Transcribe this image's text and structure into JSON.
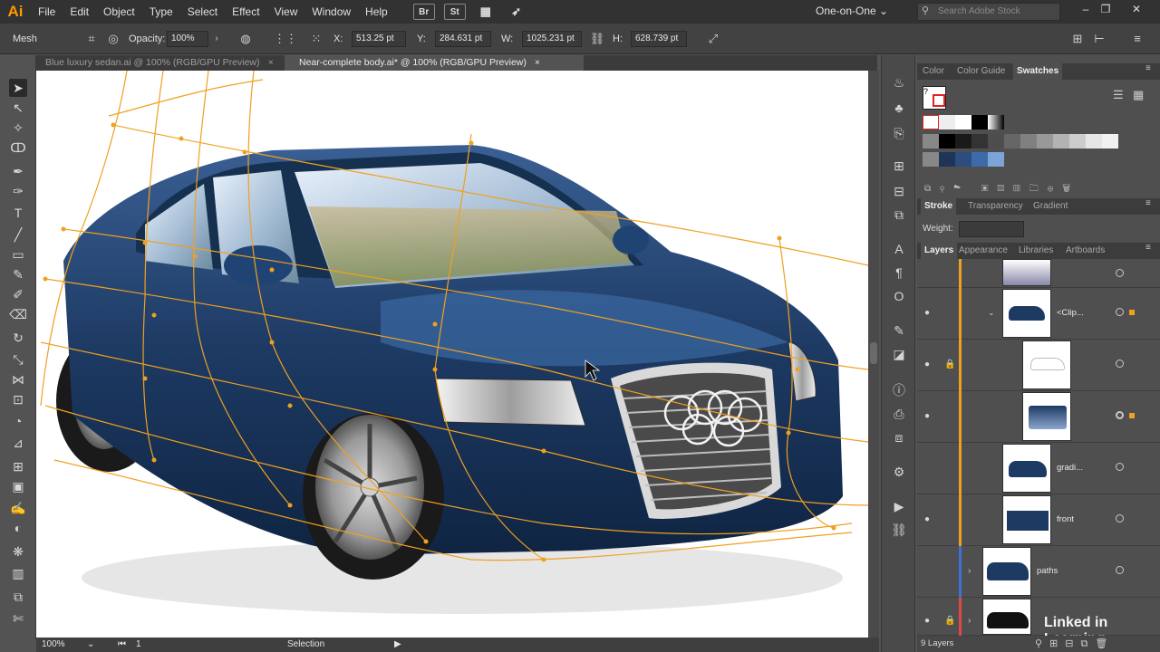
{
  "menubar": {
    "logo": "Ai",
    "items": [
      "File",
      "Edit",
      "Object",
      "Type",
      "Select",
      "Effect",
      "View",
      "Window",
      "Help"
    ],
    "bridge_label": "Br",
    "stock_label": "St",
    "workspace": "One-on-One",
    "search_placeholder": "Search Adobe Stock"
  },
  "controlbar": {
    "tool_label": "Mesh",
    "opacity_label": "Opacity:",
    "opacity_value": "100%",
    "x_label": "X:",
    "x_value": "513.25 pt",
    "y_label": "Y:",
    "y_value": "284.631 pt",
    "w_label": "W:",
    "w_value": "1025.231 pt",
    "h_label": "H:",
    "h_value": "628.739 pt"
  },
  "tabs": [
    {
      "label": "Blue luxury sedan.ai @ 100% (RGB/GPU Preview)",
      "close": "×"
    },
    {
      "label": "Near-complete body.ai* @ 100% (RGB/GPU Preview)",
      "close": "×"
    }
  ],
  "status": {
    "zoom": "100%",
    "artboard_num": "1",
    "tool": "Selection"
  },
  "panels": {
    "top_tabs": [
      "Color",
      "Color Guide",
      "Swatches"
    ],
    "mid_tabs": [
      "Stroke",
      "Transparency",
      "Gradient"
    ],
    "weight_label": "Weight:",
    "layer_tabs": [
      "Layers",
      "Appearance",
      "Libraries",
      "Artboards"
    ],
    "layers": [
      {
        "name": "<Clip..."
      },
      {
        "name": ""
      },
      {
        "name": ""
      },
      {
        "name": "gradi..."
      },
      {
        "name": "front"
      },
      {
        "name": "paths"
      }
    ],
    "layers_count": "9 Layers",
    "watermark": "Linked in Learning"
  },
  "colors": {
    "accent_orange": "#f0a020",
    "car_body": "#1d3a63",
    "swatch_blue_1": "#1f3557",
    "swatch_blue_2": "#3d6aa8",
    "swatch_blue_3": "#7da4d6"
  }
}
